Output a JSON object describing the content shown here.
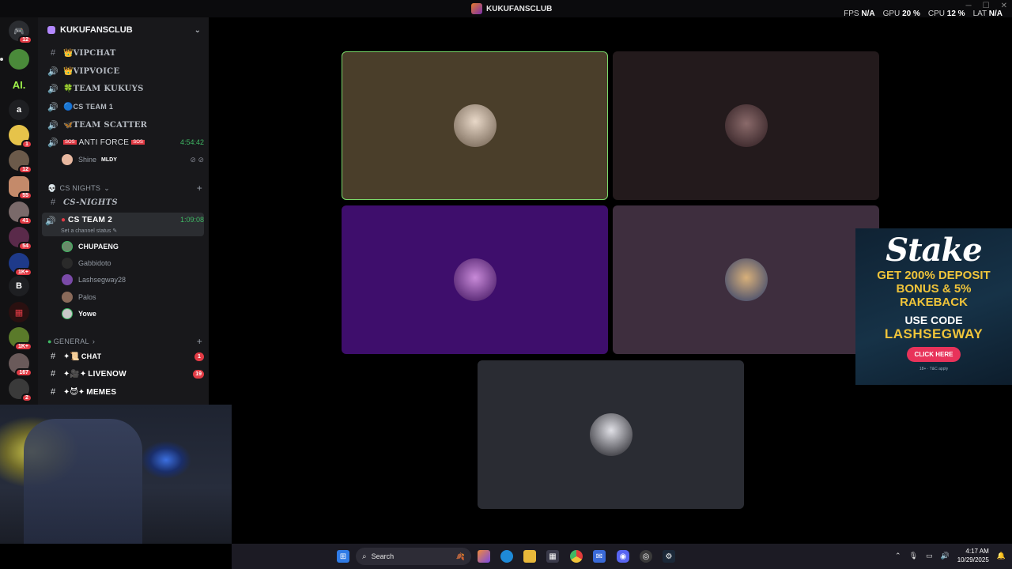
{
  "window": {
    "title": "KUKUFANSCLUB"
  },
  "stats": [
    {
      "label": "FPS",
      "value": "N/A"
    },
    {
      "label": "GPU",
      "value": "20 %"
    },
    {
      "label": "CPU",
      "value": "12 %"
    },
    {
      "label": "LAT",
      "value": "N/A"
    }
  ],
  "rail": {
    "items": [
      {
        "name": "direct-messages",
        "glyph": "",
        "badge": "12"
      },
      {
        "name": "pepe",
        "glyph": "",
        "badge": ""
      },
      {
        "name": "ai-server",
        "glyph": "AI.",
        "badge": ""
      },
      {
        "name": "a-server",
        "glyph": "a",
        "badge": ""
      },
      {
        "name": "pikachu",
        "glyph": "",
        "badge": "1"
      },
      {
        "name": "monday",
        "glyph": "",
        "badge": "12"
      },
      {
        "name": "girl",
        "glyph": "",
        "badge": "55"
      },
      {
        "name": "guy",
        "glyph": "",
        "badge": "41"
      },
      {
        "name": "anime",
        "glyph": "",
        "badge": "54"
      },
      {
        "name": "tgl",
        "glyph": "",
        "badge": "1K+"
      },
      {
        "name": "b-server",
        "glyph": "B",
        "badge": ""
      },
      {
        "name": "tgl-red",
        "glyph": "",
        "badge": ""
      },
      {
        "name": "colorful",
        "glyph": "",
        "badge": "1K+"
      },
      {
        "name": "avs",
        "glyph": "",
        "badge": "167"
      },
      {
        "name": "voice",
        "glyph": "",
        "badge": "2"
      }
    ]
  },
  "server": {
    "name": "KUKUFANSCLUB"
  },
  "channels": {
    "top": [
      {
        "icon": "#",
        "emoji": "👑",
        "label": "VIPCHAT"
      },
      {
        "icon": "🔊",
        "emoji": "👑",
        "label": "VIPVOICE"
      },
      {
        "icon": "🔊",
        "emoji": "🍀",
        "label": "TEAM KUKUYS"
      },
      {
        "icon": "🔊",
        "emoji": "🔵",
        "label": "CS TEAM 1"
      },
      {
        "icon": "🔊",
        "emoji": "🦋",
        "label": "TEAM SCATTER"
      }
    ],
    "anti_force": {
      "label": "ANTI FORCE",
      "time": "4:54:42"
    },
    "anti_force_member": {
      "name": "Shine",
      "tag": "MLDY"
    },
    "cs_nights_category": "CS NIGHTS",
    "cs_nights_channel": "CS-NIGHTS",
    "cs_team2": {
      "label": "CS TEAM 2",
      "time": "1:09:08",
      "status": "Set a channel status"
    },
    "cs_team2_members": [
      "CHUPAENG",
      "Gabbidoto",
      "Lashsegway28",
      "Palos",
      "Yowe"
    ],
    "general_category": "GENERAL",
    "general_channels": [
      {
        "label": "CHAT",
        "badge": "1"
      },
      {
        "label": "LIVENOW",
        "badge": "19"
      },
      {
        "label": "MEMES",
        "badge": ""
      }
    ]
  },
  "ad": {
    "brand": "Stake",
    "line1": "GET 200% DEPOSIT",
    "line2": "BONUS & 5%",
    "line3": "RAKEBACK",
    "use": "USE CODE",
    "code": "LASHSEGWAY",
    "button": "CLICK HERE",
    "fine": "18+ · T&C apply"
  },
  "taskbar": {
    "search_placeholder": "Search",
    "time": "4:17 AM",
    "date": "10/29/2025"
  }
}
